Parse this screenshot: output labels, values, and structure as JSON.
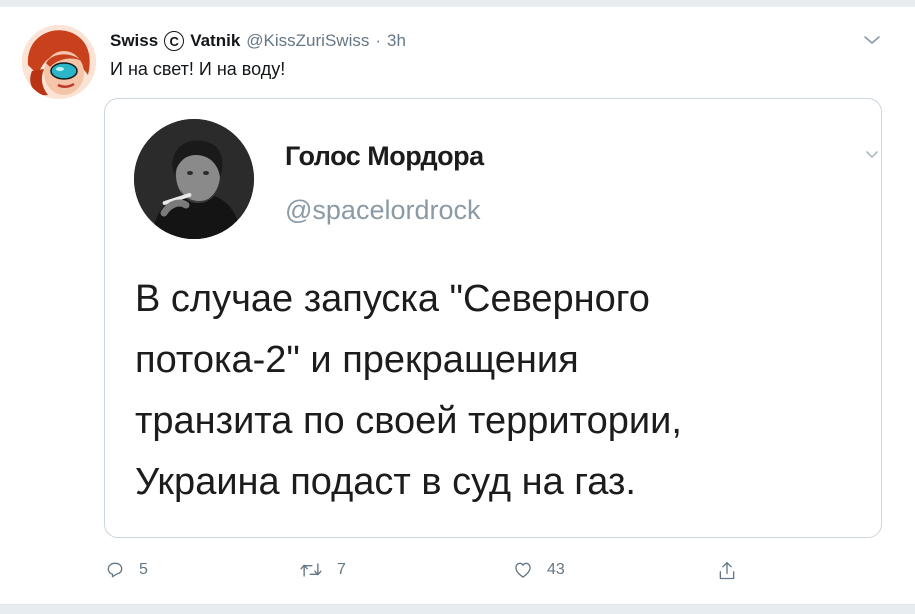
{
  "tweet": {
    "author_name": "Swiss",
    "copyright_symbol": "C",
    "author_name_2": "Vatnik",
    "handle": "@KissZuriSwiss",
    "separator": "·",
    "time": "3h",
    "text": "И на свет! И на воду!"
  },
  "quoted": {
    "name": "Голос Мордора",
    "handle": "@spacelordrock",
    "lines": [
      "В случае запуска \"Северного",
      "потока-2\" и прекращения",
      "транзита по своей территории,",
      "Украина подаст в суд на газ."
    ]
  },
  "actions": {
    "reply_count": "5",
    "retweet_count": "7",
    "like_count": "43"
  },
  "colors": {
    "text": "#14171a",
    "muted": "#657786",
    "border": "#ccd6dd",
    "background": "#ffffff"
  },
  "icons": [
    "chevron-down-icon",
    "reply-icon",
    "retweet-icon",
    "like-icon",
    "share-icon"
  ]
}
